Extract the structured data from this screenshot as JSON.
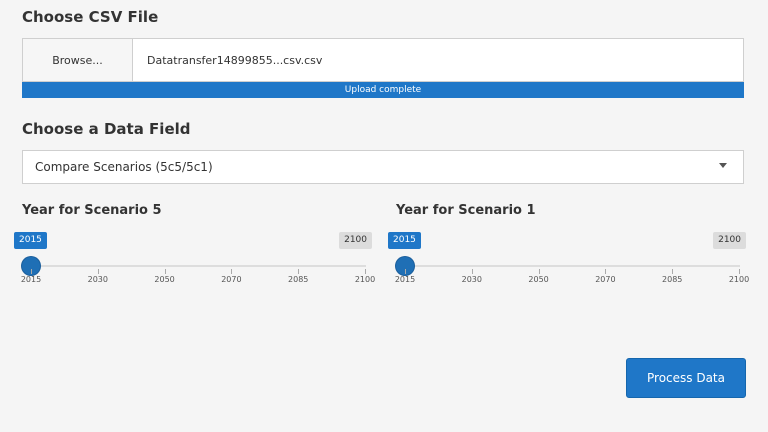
{
  "csv_section": {
    "title": "Choose CSV File",
    "browse_label": "Browse...",
    "file_name": "Datatransfer14899855...csv.csv",
    "upload_status": "Upload complete",
    "upload_progress": 1.0
  },
  "field_section": {
    "title": "Choose a Data Field",
    "selected_value": "Compare Scenarios (5c5/5c1)"
  },
  "sliders": [
    {
      "label": "Year for Scenario 5",
      "value": "2015",
      "max": "2100",
      "ticks": [
        "2015",
        "2030",
        "2050",
        "2070",
        "2085",
        "2100"
      ]
    },
    {
      "label": "Year for Scenario 1",
      "value": "2015",
      "max": "2100",
      "ticks": [
        "2015",
        "2030",
        "2050",
        "2070",
        "2085",
        "2100"
      ]
    }
  ],
  "actions": {
    "process_label": "Process Data"
  },
  "colors": {
    "accent": "#1f77c8",
    "background": "#f5f5f5"
  }
}
